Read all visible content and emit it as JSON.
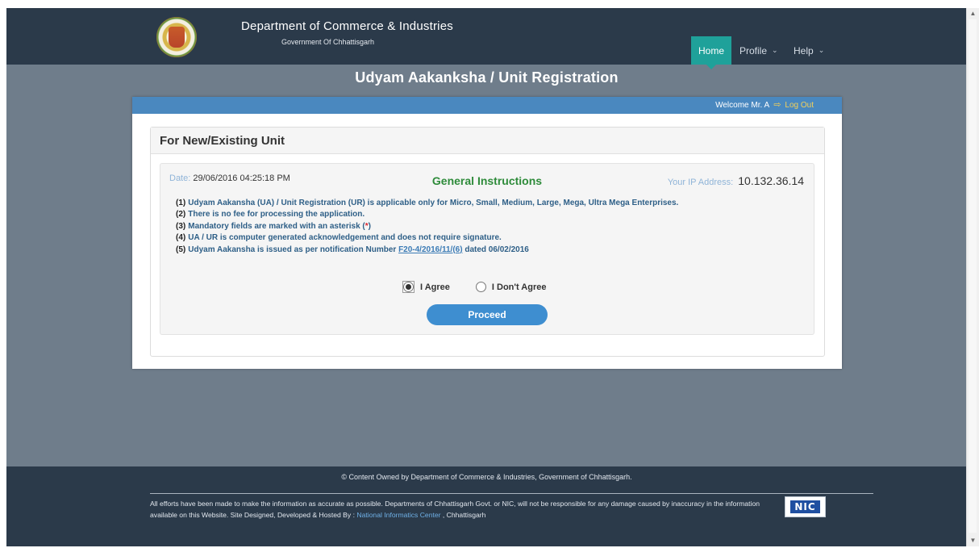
{
  "header": {
    "dept_title": "Department of Commerce & Industries",
    "dept_sub": "Government Of Chhattisgarh",
    "nav": {
      "home": "Home",
      "profile": "Profile",
      "help": "Help"
    }
  },
  "page_title": "Udyam Aakanksha / Unit Registration",
  "panel": {
    "welcome": "Welcome Mr. A",
    "logout": "Log Out",
    "card_title": "For New/Existing Unit",
    "date_label": "Date:",
    "date_value": "29/06/2016 04:25:18 PM",
    "gi_title": "General Instructions",
    "ip_label": "Your IP Address:",
    "ip_value": "10.132.36.14",
    "instructions": [
      {
        "num": "(1)",
        "text": "Udyam Aakansha (UA) / Unit Registration (UR) is applicable only for Micro, Small, Medium, Large, Mega, Ultra Mega Enterprises."
      },
      {
        "num": "(2)",
        "text": "There is no fee for processing the application."
      },
      {
        "num": "(3)",
        "text_before": "Mandatory fields are marked with an asterisk (",
        "star": "*",
        "text_after": ")"
      },
      {
        "num": "(4)",
        "text": "UA / UR is computer generated acknowledgement and does not require signature."
      },
      {
        "num": "(5)",
        "text_before": "Udyam Aakansha is issued as per notification Number ",
        "link": "F20-4/2016/11/(6)",
        "text_after": " dated 06/02/2016"
      }
    ],
    "agree_label": "I Agree",
    "disagree_label": "I Don't Agree",
    "selected": "agree",
    "proceed_label": "Proceed"
  },
  "footer": {
    "copyright": "© Content Owned by Department of Commerce & Industries, Government of Chhattisgarh.",
    "disclaimer_before": "All efforts have been made to make the information as accurate as possible. Departments of Chhattisgarh Govt. or NIC, will not be responsible for any damage caused by inaccuracy in the information available on this Website. Site Designed, Developed & Hosted By : ",
    "nic_link": "National Informatics Center",
    "disclaimer_after": " , Chhattisgarh",
    "nic_logo": "NIC"
  },
  "colors": {
    "header_bg": "#2b3a4a",
    "page_bg": "#6f7d8b",
    "accent_teal": "#1fa19a",
    "panel_bar": "#4a88bf",
    "green_title": "#2e8b3a",
    "button_blue": "#3e8ed0"
  }
}
